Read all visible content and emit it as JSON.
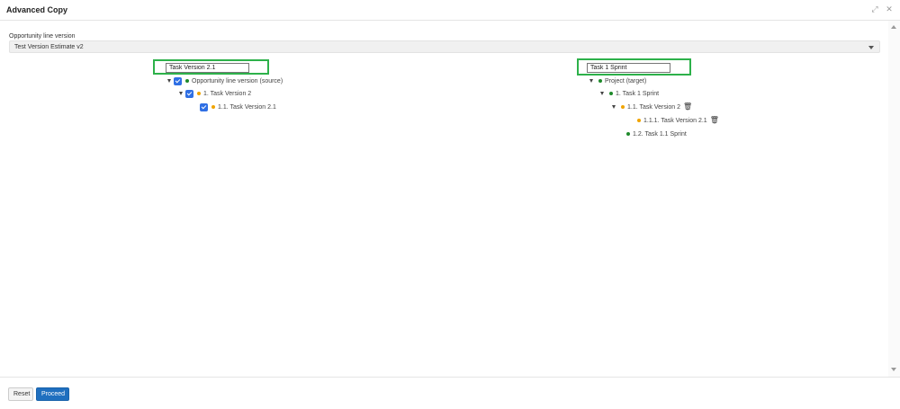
{
  "dialog": {
    "title": "Advanced Copy",
    "icons": [
      "expand-icon",
      "close-icon"
    ]
  },
  "opportunity": {
    "label": "Opportunity line version",
    "selected": "Test Version Estimate v2"
  },
  "source": {
    "search_value": "Task Version 2.1",
    "root": "Opportunity line version (source)",
    "child": "1. Task Version 2",
    "grandchild": "1.1. Task Version 2.1"
  },
  "target": {
    "search_value": "Task 1 Sprint",
    "root": "Project (target)",
    "child1": "1. Task 1 Sprint",
    "child1_1": "1.1. Task Version 2",
    "child1_1_1": "1.1.1. Task Version 2.1",
    "child1_2": "1.2. Task 1.1 Sprint"
  },
  "footer": {
    "reset_label": "Reset",
    "proceed_label": "Proceed"
  },
  "colors": {
    "highlight": "#2db14a",
    "checkbox": "#2f6fe4",
    "dot_green": "#1f8a2b",
    "dot_orange": "#f0a400",
    "primary_button": "#1f6fbf"
  }
}
